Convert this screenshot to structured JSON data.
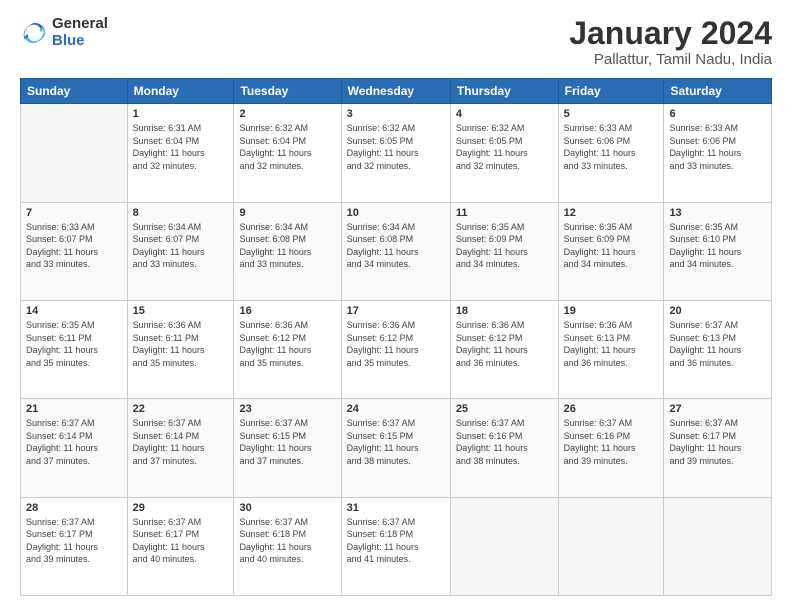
{
  "logo": {
    "general": "General",
    "blue": "Blue"
  },
  "header": {
    "title": "January 2024",
    "subtitle": "Pallattur, Tamil Nadu, India"
  },
  "weekdays": [
    "Sunday",
    "Monday",
    "Tuesday",
    "Wednesday",
    "Thursday",
    "Friday",
    "Saturday"
  ],
  "weeks": [
    [
      {
        "day": "",
        "empty": true
      },
      {
        "day": "1",
        "sunrise": "Sunrise: 6:31 AM",
        "sunset": "Sunset: 6:04 PM",
        "daylight": "Daylight: 11 hours and 32 minutes."
      },
      {
        "day": "2",
        "sunrise": "Sunrise: 6:32 AM",
        "sunset": "Sunset: 6:04 PM",
        "daylight": "Daylight: 11 hours and 32 minutes."
      },
      {
        "day": "3",
        "sunrise": "Sunrise: 6:32 AM",
        "sunset": "Sunset: 6:05 PM",
        "daylight": "Daylight: 11 hours and 32 minutes."
      },
      {
        "day": "4",
        "sunrise": "Sunrise: 6:32 AM",
        "sunset": "Sunset: 6:05 PM",
        "daylight": "Daylight: 11 hours and 32 minutes."
      },
      {
        "day": "5",
        "sunrise": "Sunrise: 6:33 AM",
        "sunset": "Sunset: 6:06 PM",
        "daylight": "Daylight: 11 hours and 33 minutes."
      },
      {
        "day": "6",
        "sunrise": "Sunrise: 6:33 AM",
        "sunset": "Sunset: 6:06 PM",
        "daylight": "Daylight: 11 hours and 33 minutes."
      }
    ],
    [
      {
        "day": "7",
        "sunrise": "Sunrise: 6:33 AM",
        "sunset": "Sunset: 6:07 PM",
        "daylight": "Daylight: 11 hours and 33 minutes."
      },
      {
        "day": "8",
        "sunrise": "Sunrise: 6:34 AM",
        "sunset": "Sunset: 6:07 PM",
        "daylight": "Daylight: 11 hours and 33 minutes."
      },
      {
        "day": "9",
        "sunrise": "Sunrise: 6:34 AM",
        "sunset": "Sunset: 6:08 PM",
        "daylight": "Daylight: 11 hours and 33 minutes."
      },
      {
        "day": "10",
        "sunrise": "Sunrise: 6:34 AM",
        "sunset": "Sunset: 6:08 PM",
        "daylight": "Daylight: 11 hours and 34 minutes."
      },
      {
        "day": "11",
        "sunrise": "Sunrise: 6:35 AM",
        "sunset": "Sunset: 6:09 PM",
        "daylight": "Daylight: 11 hours and 34 minutes."
      },
      {
        "day": "12",
        "sunrise": "Sunrise: 6:35 AM",
        "sunset": "Sunset: 6:09 PM",
        "daylight": "Daylight: 11 hours and 34 minutes."
      },
      {
        "day": "13",
        "sunrise": "Sunrise: 6:35 AM",
        "sunset": "Sunset: 6:10 PM",
        "daylight": "Daylight: 11 hours and 34 minutes."
      }
    ],
    [
      {
        "day": "14",
        "sunrise": "Sunrise: 6:35 AM",
        "sunset": "Sunset: 6:11 PM",
        "daylight": "Daylight: 11 hours and 35 minutes."
      },
      {
        "day": "15",
        "sunrise": "Sunrise: 6:36 AM",
        "sunset": "Sunset: 6:11 PM",
        "daylight": "Daylight: 11 hours and 35 minutes."
      },
      {
        "day": "16",
        "sunrise": "Sunrise: 6:36 AM",
        "sunset": "Sunset: 6:12 PM",
        "daylight": "Daylight: 11 hours and 35 minutes."
      },
      {
        "day": "17",
        "sunrise": "Sunrise: 6:36 AM",
        "sunset": "Sunset: 6:12 PM",
        "daylight": "Daylight: 11 hours and 35 minutes."
      },
      {
        "day": "18",
        "sunrise": "Sunrise: 6:36 AM",
        "sunset": "Sunset: 6:12 PM",
        "daylight": "Daylight: 11 hours and 36 minutes."
      },
      {
        "day": "19",
        "sunrise": "Sunrise: 6:36 AM",
        "sunset": "Sunset: 6:13 PM",
        "daylight": "Daylight: 11 hours and 36 minutes."
      },
      {
        "day": "20",
        "sunrise": "Sunrise: 6:37 AM",
        "sunset": "Sunset: 6:13 PM",
        "daylight": "Daylight: 11 hours and 36 minutes."
      }
    ],
    [
      {
        "day": "21",
        "sunrise": "Sunrise: 6:37 AM",
        "sunset": "Sunset: 6:14 PM",
        "daylight": "Daylight: 11 hours and 37 minutes."
      },
      {
        "day": "22",
        "sunrise": "Sunrise: 6:37 AM",
        "sunset": "Sunset: 6:14 PM",
        "daylight": "Daylight: 11 hours and 37 minutes."
      },
      {
        "day": "23",
        "sunrise": "Sunrise: 6:37 AM",
        "sunset": "Sunset: 6:15 PM",
        "daylight": "Daylight: 11 hours and 37 minutes."
      },
      {
        "day": "24",
        "sunrise": "Sunrise: 6:37 AM",
        "sunset": "Sunset: 6:15 PM",
        "daylight": "Daylight: 11 hours and 38 minutes."
      },
      {
        "day": "25",
        "sunrise": "Sunrise: 6:37 AM",
        "sunset": "Sunset: 6:16 PM",
        "daylight": "Daylight: 11 hours and 38 minutes."
      },
      {
        "day": "26",
        "sunrise": "Sunrise: 6:37 AM",
        "sunset": "Sunset: 6:16 PM",
        "daylight": "Daylight: 11 hours and 39 minutes."
      },
      {
        "day": "27",
        "sunrise": "Sunrise: 6:37 AM",
        "sunset": "Sunset: 6:17 PM",
        "daylight": "Daylight: 11 hours and 39 minutes."
      }
    ],
    [
      {
        "day": "28",
        "sunrise": "Sunrise: 6:37 AM",
        "sunset": "Sunset: 6:17 PM",
        "daylight": "Daylight: 11 hours and 39 minutes."
      },
      {
        "day": "29",
        "sunrise": "Sunrise: 6:37 AM",
        "sunset": "Sunset: 6:17 PM",
        "daylight": "Daylight: 11 hours and 40 minutes."
      },
      {
        "day": "30",
        "sunrise": "Sunrise: 6:37 AM",
        "sunset": "Sunset: 6:18 PM",
        "daylight": "Daylight: 11 hours and 40 minutes."
      },
      {
        "day": "31",
        "sunrise": "Sunrise: 6:37 AM",
        "sunset": "Sunset: 6:18 PM",
        "daylight": "Daylight: 11 hours and 41 minutes."
      },
      {
        "day": "",
        "empty": true
      },
      {
        "day": "",
        "empty": true
      },
      {
        "day": "",
        "empty": true
      }
    ]
  ]
}
